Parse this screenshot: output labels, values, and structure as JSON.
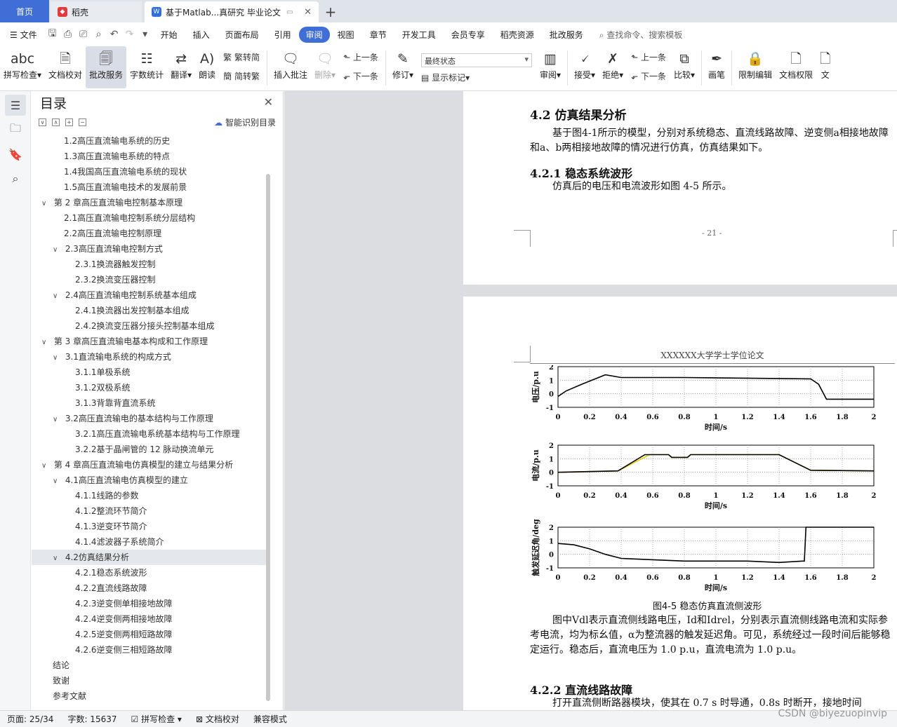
{
  "titlebar": {
    "home_tab": "首页",
    "tabs": [
      {
        "label": "稻壳",
        "icon": "docer-icon"
      },
      {
        "label": "基于Matlab...真研究 毕业论文",
        "icon": "word-doc-icon"
      }
    ],
    "new_tab": "+"
  },
  "menubar": {
    "file": "文件",
    "items": [
      "开始",
      "插入",
      "页面布局",
      "引用",
      "审阅",
      "视图",
      "章节",
      "开发工具",
      "会员专享",
      "稻壳资源",
      "批改服务"
    ],
    "active": "审阅",
    "search": "查找命令、搜索模板"
  },
  "ribbon": {
    "spellcheck": "拼写检查",
    "doc_check": "文档校对",
    "revise_service": "批改服务",
    "word_count": "字数统计",
    "translate": "翻译",
    "read_aloud": "朗读",
    "trad_simp": "繁转简",
    "simp_trad": "简转繁",
    "insert_comment": "插入批注",
    "delete": "删除",
    "prev": "上一条",
    "next": "下一条",
    "revise": "修订",
    "final_state": "最终状态",
    "show_marks": "显示标记",
    "review": "审阅",
    "accept": "接受",
    "reject": "拒绝",
    "prev2": "上一条",
    "next2": "下一条",
    "compare": "比较",
    "pen": "画笔",
    "restrict_edit": "限制编辑",
    "doc_rights": "文档权限",
    "doc_more": "文"
  },
  "toc": {
    "title": "目录",
    "smart": "智能识别目录",
    "items": [
      {
        "text": "1.2高压直流输电系统的历史",
        "level": 2,
        "caret": ""
      },
      {
        "text": "1.3高压直流输电系统的特点",
        "level": 2,
        "caret": ""
      },
      {
        "text": "1.4我国高压直流输电系统的现状",
        "level": 2,
        "caret": ""
      },
      {
        "text": "1.5高压直流输电技术的发展前景",
        "level": 2,
        "caret": ""
      },
      {
        "text": "第 2 章高压直流输电控制基本原理",
        "level": 1,
        "caret": "∨"
      },
      {
        "text": "2.1高压直流输电控制系统分层结构",
        "level": 2,
        "caret": ""
      },
      {
        "text": "2.2高压直流输电控制原理",
        "level": 2,
        "caret": ""
      },
      {
        "text": "2.3高压直流输电控制方式",
        "level": 2,
        "caret": "∨"
      },
      {
        "text": "2.3.1换流器触发控制",
        "level": 3,
        "caret": ""
      },
      {
        "text": "2.3.2换流变压器控制",
        "level": 3,
        "caret": ""
      },
      {
        "text": "2.4高压直流输电控制系统基本组成",
        "level": 2,
        "caret": "∨"
      },
      {
        "text": "2.4.1换流器出发控制基本组成",
        "level": 3,
        "caret": ""
      },
      {
        "text": "2.4.2换流变压器分接头控制基本组成",
        "level": 3,
        "caret": ""
      },
      {
        "text": "第 3 章高压直流输电基本构成和工作原理",
        "level": 1,
        "caret": "∨"
      },
      {
        "text": "3.1直流输电系统的构成方式",
        "level": 2,
        "caret": "∨"
      },
      {
        "text": "3.1.1单极系统",
        "level": 3,
        "caret": ""
      },
      {
        "text": "3.1.2双极系统",
        "level": 3,
        "caret": ""
      },
      {
        "text": "3.1.3背靠背直流系统",
        "level": 3,
        "caret": ""
      },
      {
        "text": "3.2高压直流输电的基本结构与工作原理",
        "level": 2,
        "caret": "∨"
      },
      {
        "text": "3.2.1高压直流输电系统基本结构与工作原理",
        "level": 3,
        "caret": ""
      },
      {
        "text": "3.2.2基于晶闸管的 12 脉动换流单元",
        "level": 3,
        "caret": ""
      },
      {
        "text": "第 4 章高压直流输电仿真模型的建立与结果分析",
        "level": 1,
        "caret": "∨"
      },
      {
        "text": "4.1高压直流输电仿真模型的建立",
        "level": 2,
        "caret": "∨"
      },
      {
        "text": "4.1.1线路的参数",
        "level": 3,
        "caret": ""
      },
      {
        "text": "4.1.2整流环节简介",
        "level": 3,
        "caret": ""
      },
      {
        "text": "4.1.3逆变环节简介",
        "level": 3,
        "caret": ""
      },
      {
        "text": "4.1.4滤波器子系统简介",
        "level": 3,
        "caret": ""
      },
      {
        "text": "4.2仿真结果分析",
        "level": 2,
        "caret": "∨",
        "selected": true
      },
      {
        "text": "4.2.1稳态系统波形",
        "level": 3,
        "caret": ""
      },
      {
        "text": "4.2.2直流线路故障",
        "level": 3,
        "caret": ""
      },
      {
        "text": "4.2.3逆变侧单相接地故障",
        "level": 3,
        "caret": ""
      },
      {
        "text": "4.2.4逆变侧两相接地故障",
        "level": 3,
        "caret": ""
      },
      {
        "text": "4.2.5逆变侧两相短路故障",
        "level": 3,
        "caret": ""
      },
      {
        "text": "4.2.6逆变侧三相短路故障",
        "level": 3,
        "caret": ""
      },
      {
        "text": "结论",
        "level": 1,
        "caret": ""
      },
      {
        "text": "致谢",
        "level": 1,
        "caret": ""
      },
      {
        "text": "参考文献",
        "level": 1,
        "caret": ""
      }
    ]
  },
  "doc": {
    "h42": "4.2 仿真结果分析",
    "p1": "基于图4-1所示的模型，分别对系统稳态、直流线路故障、逆变侧a相接地故障和a、b两相接地故障的情况进行仿真，仿真结果如下。",
    "h421": "4.2.1 稳态系统波形",
    "p2": "仿真后的电压和电流波形如图 4-5 所示。",
    "page_number": "- 21 -",
    "header": "XXXXXX大学学士学位论文",
    "caption": "图4-5 稳态仿真直流侧波形",
    "p3": "图中Vdl表示直流侧线路电压，Id和Idrel，分别表示直流侧线路电流和实际参考电流，均为标幺值，α为整流器的触发延迟角。可见，系统经过一段时间后能够稳定运行。稳态后，直流电压为 1.0 p.u，直流电流为 1.0 p.u。",
    "h422": "4.2.2 直流线路故障",
    "p4": "打开直流侧断路器模块，使其在 0.7 s 时导通，0.8s 时断开，接地时间"
  },
  "chart_data": [
    {
      "type": "line",
      "ylabel": "电压/p.u",
      "xlabel": "时间/s",
      "xlim": [
        0,
        2
      ],
      "ylim": [
        -1,
        2
      ],
      "xticks": [
        "0",
        "0.2",
        "0.4",
        "0.6",
        "0.8",
        "1",
        "1.2",
        "1.4",
        "1.6",
        "1.8",
        "2"
      ],
      "yticks": [
        "-1",
        "0",
        "1",
        "2"
      ],
      "grid": true,
      "series": [
        {
          "color": "#000000",
          "x": [
            0,
            0.05,
            0.15,
            0.3,
            0.4,
            0.8,
            1.6,
            1.65,
            1.7,
            1.8,
            2
          ],
          "y": [
            -0.2,
            0.2,
            0.7,
            1.4,
            1.2,
            1.2,
            1.1,
            0.7,
            -0.4,
            -0.4,
            -0.4
          ]
        }
      ]
    },
    {
      "type": "line",
      "ylabel": "电流/p.u",
      "xlabel": "时间/s",
      "xlim": [
        0,
        2
      ],
      "ylim": [
        -1,
        2
      ],
      "xticks": [
        "0",
        "0.2",
        "0.4",
        "0.6",
        "0.8",
        "1",
        "1.2",
        "1.4",
        "1.6",
        "1.8",
        "2"
      ],
      "yticks": [
        "-1",
        "0",
        "1",
        "2"
      ],
      "grid": true,
      "series": [
        {
          "color": "#000000",
          "x": [
            0,
            0.38,
            0.55,
            0.7,
            0.72,
            0.82,
            0.84,
            1.4,
            1.6,
            2
          ],
          "y": [
            0,
            0.1,
            1.3,
            1.3,
            1.1,
            1.1,
            1.3,
            1.3,
            0.15,
            0.1
          ]
        },
        {
          "color": "#e6d200",
          "x": [
            0,
            0.38,
            0.58,
            0.7,
            0.72,
            0.82,
            0.84,
            1.4,
            1.6,
            2
          ],
          "y": [
            0,
            0.1,
            1.3,
            1.3,
            1.1,
            1.1,
            1.3,
            1.3,
            0.15,
            0.1
          ]
        }
      ]
    },
    {
      "type": "line",
      "ylabel": "触发延迟角/deg",
      "xlabel": "时间/s",
      "xlim": [
        0,
        2
      ],
      "ylim": [
        -1,
        2
      ],
      "xticks": [
        "0",
        "0.2",
        "0.4",
        "0.6",
        "0.8",
        "1",
        "1.2",
        "1.4",
        "1.6",
        "1.8",
        "2"
      ],
      "yticks": [
        "-1",
        "0",
        "1",
        "2"
      ],
      "grid": true,
      "series": [
        {
          "color": "#000000",
          "x": [
            0,
            0.1,
            0.2,
            0.3,
            0.4,
            0.6,
            0.8,
            1,
            1.2,
            1.4,
            1.55,
            1.56,
            1.57,
            2
          ],
          "y": [
            0.8,
            0.7,
            0.4,
            0,
            -0.3,
            -0.4,
            -0.5,
            -0.5,
            -0.5,
            -0.6,
            -0.5,
            -0.5,
            2,
            2
          ]
        }
      ]
    }
  ],
  "statusbar": {
    "page": "页面: 25/34",
    "words": "字数: 15637",
    "spell": "拼写检查",
    "check": "文档校对",
    "compat": "兼容模式"
  },
  "watermark": "CSDN @biyezuopinvip"
}
